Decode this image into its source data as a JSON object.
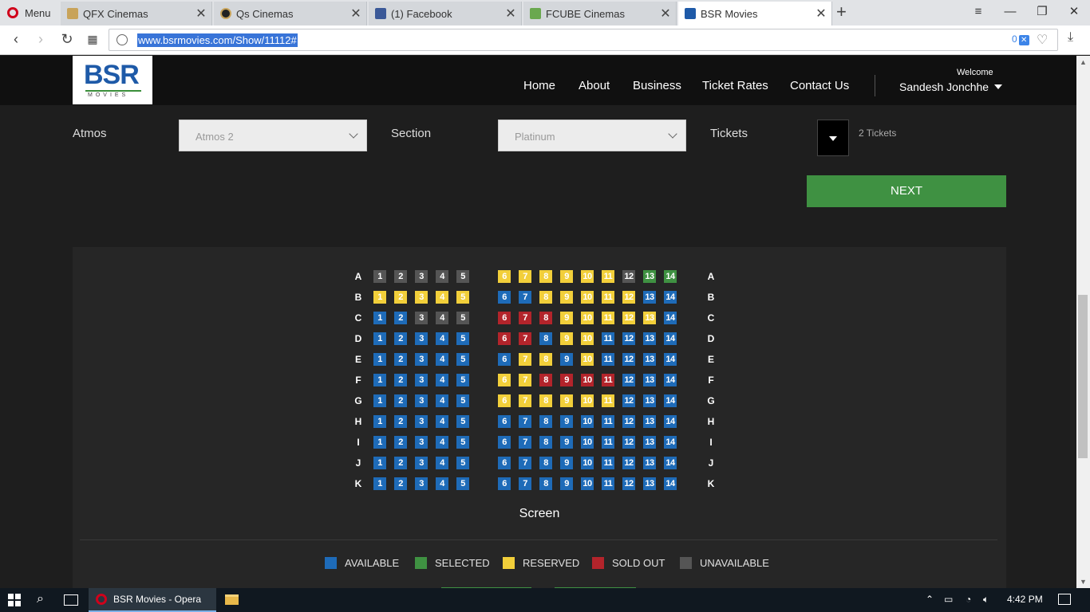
{
  "browser": {
    "menu_label": "Menu",
    "tabs": [
      {
        "title": "QFX Cinemas",
        "favicon_color": "#c8a35a"
      },
      {
        "title": "Qs Cinemas",
        "favicon_color": "#222222"
      },
      {
        "title": "(1) Facebook",
        "favicon_color": "#3b5998"
      },
      {
        "title": "FCUBE Cinemas",
        "favicon_color": "#6aa84f"
      },
      {
        "title": "BSR Movies",
        "favicon_color": "#1e5aa8"
      }
    ],
    "url": "www.bsrmovies.com/Show/11112#",
    "adblock_count": "0"
  },
  "site": {
    "logo_text": "BSR",
    "logo_sub": "MOVIES",
    "nav": [
      "Home",
      "About",
      "Business",
      "Ticket Rates",
      "Contact Us"
    ],
    "welcome": "Welcome",
    "username": "Sandesh Jonchhe",
    "filters": {
      "atmos_label": "Atmos",
      "atmos_value": "Atmos 2",
      "section_label": "Section",
      "section_value": "Platinum",
      "tickets_label": "Tickets",
      "tickets_value": "2 Tickets"
    },
    "next_label": "NEXT",
    "screen_label": "Screen",
    "legend": [
      {
        "label": "AVAILABLE",
        "color": "#1e6bb8"
      },
      {
        "label": "SELECTED",
        "color": "#3f9142"
      },
      {
        "label": "RESERVED",
        "color": "#f2cf3a"
      },
      {
        "label": "SOLD OUT",
        "color": "#b3242b"
      },
      {
        "label": "UNAVAILABLE",
        "color": "#555555"
      }
    ]
  },
  "seat_colors": {
    "A": "#1e6bb8",
    "S": "#3f9142",
    "R": "#f2cf3a",
    "X": "#b3242b",
    "U": "#555555"
  },
  "seatmap": {
    "left_numbers": [
      1,
      2,
      3,
      4,
      5
    ],
    "right_numbers": [
      6,
      7,
      8,
      9,
      10,
      11,
      12,
      13,
      14
    ],
    "rows": [
      {
        "label": "A",
        "left": "UUUUU",
        "right": "RRRRRRUSS"
      },
      {
        "label": "B",
        "left": "RRRRR",
        "right": "AARRRRRAA"
      },
      {
        "label": "C",
        "left": "AAUUU",
        "right": "XXXRRRRRA"
      },
      {
        "label": "D",
        "left": "AAAAA",
        "right": "XXARRAAAA"
      },
      {
        "label": "E",
        "left": "AAAAA",
        "right": "ARRARAAAA"
      },
      {
        "label": "F",
        "left": "AAAAA",
        "right": "RRXXXXAAA"
      },
      {
        "label": "G",
        "left": "AAAAA",
        "right": "RRRRRRAAA"
      },
      {
        "label": "H",
        "left": "AAAAA",
        "right": "AAAAAAAAA"
      },
      {
        "label": "I",
        "left": "AAAAA",
        "right": "AAAAAAAAA"
      },
      {
        "label": "J",
        "left": "AAAAA",
        "right": "AAAAAAAAA"
      },
      {
        "label": "K",
        "left": "AAAAA",
        "right": "AAAAAAAAA"
      }
    ]
  },
  "taskbar": {
    "active_app": "BSR Movies - Opera",
    "time": "4:42 PM"
  }
}
